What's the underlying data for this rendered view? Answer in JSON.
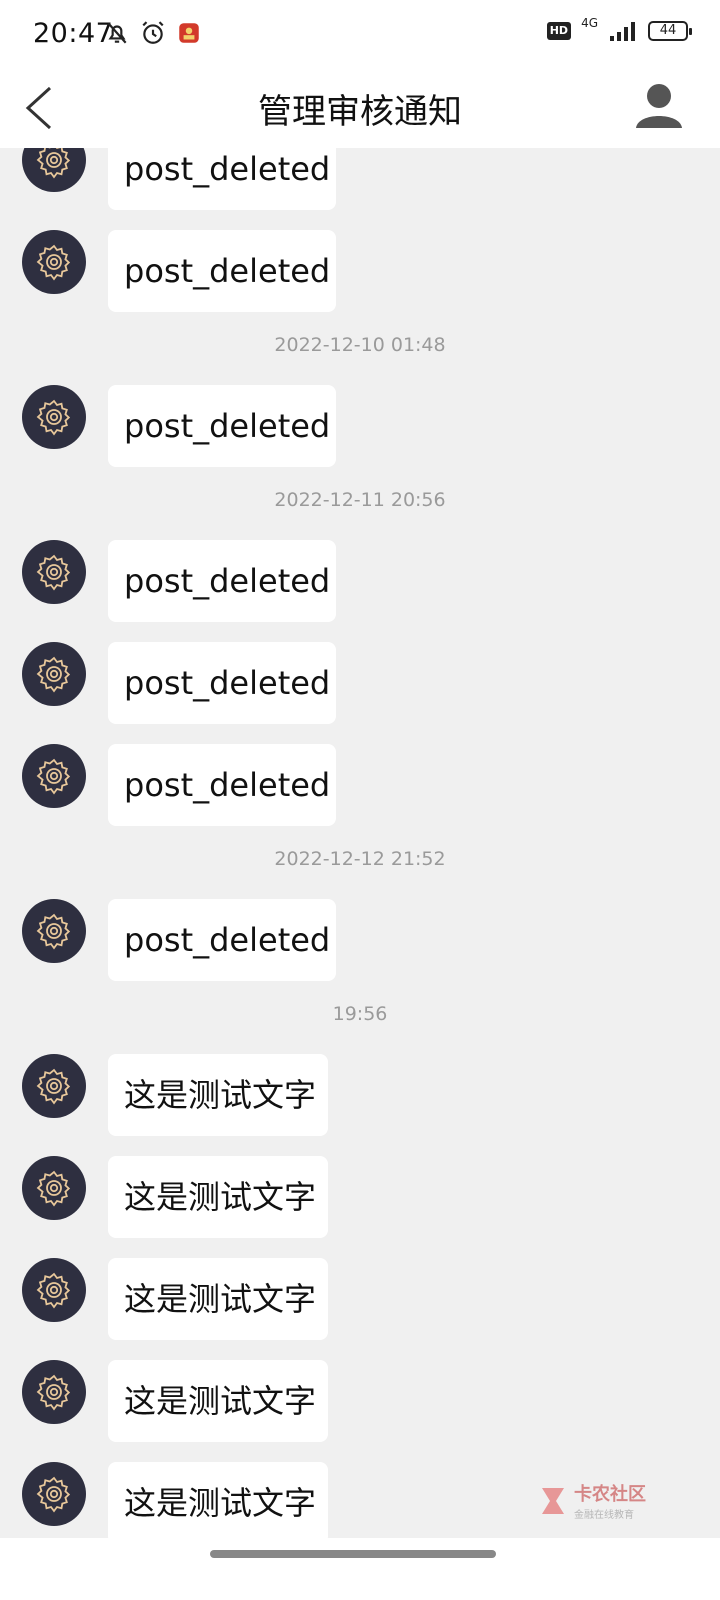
{
  "status_bar": {
    "time": "20:47",
    "hd": "HD",
    "network": "4G",
    "battery": "44",
    "icons": [
      "bell-off-icon",
      "alarm-icon",
      "app-badge-icon",
      "signal-icon",
      "battery-icon"
    ]
  },
  "header": {
    "title": "管理审核通知",
    "back_icon": "chevron-left-icon",
    "profile_icon": "user-icon"
  },
  "messages": [
    {
      "type": "message",
      "text": "post_deleted"
    },
    {
      "type": "message",
      "text": "post_deleted"
    },
    {
      "type": "time",
      "text": "2022-12-10 01:48"
    },
    {
      "type": "message",
      "text": "post_deleted"
    },
    {
      "type": "time",
      "text": "2022-12-11 20:56"
    },
    {
      "type": "message",
      "text": "post_deleted"
    },
    {
      "type": "message",
      "text": "post_deleted"
    },
    {
      "type": "message",
      "text": "post_deleted"
    },
    {
      "type": "time",
      "text": "2022-12-12 21:52"
    },
    {
      "type": "message",
      "text": "post_deleted"
    },
    {
      "type": "time",
      "text": "19:56"
    },
    {
      "type": "message",
      "text": "这是测试文字"
    },
    {
      "type": "message",
      "text": "这是测试文字"
    },
    {
      "type": "message",
      "text": "这是测试文字"
    },
    {
      "type": "message",
      "text": "这是测试文字"
    },
    {
      "type": "message",
      "text": "这是测试文字"
    }
  ],
  "avatar_icon": "gear-icon",
  "watermark": {
    "title": "卡农社区",
    "subtitle": "金融在线教育"
  },
  "colors": {
    "background": "#f0f0f0",
    "avatar": "#2e2f40",
    "gear": "#e7c79a",
    "bubble": "#ffffff"
  }
}
